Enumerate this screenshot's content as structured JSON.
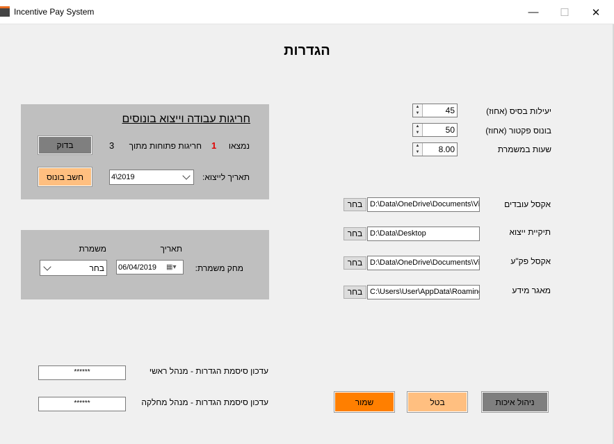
{
  "window": {
    "title": "Incentive Pay System",
    "minimize": "—",
    "maximize": "☐",
    "close": "✕"
  },
  "page_title": "הגדרות",
  "settings": {
    "base_efficiency_label": "יעילות בסיס (אחוז)",
    "base_efficiency_value": "45",
    "factor_bonus_label": "בונוס פקטור (אחוז)",
    "factor_bonus_value": "50",
    "shift_hours_label": "שעות במשמרת",
    "shift_hours_value": "8.00"
  },
  "paths": {
    "browse_label": "בחר",
    "employees_excel_label": "אקסל עובדים",
    "employees_excel_value": "D:\\Data\\OneDrive\\Documents\\Visual",
    "export_folder_label": "תיקיית ייצוא",
    "export_folder_value": "D:\\Data\\Desktop",
    "pkaa_excel_label": "אקסל פק\"ע",
    "pkaa_excel_value": "D:\\Data\\OneDrive\\Documents\\Visual",
    "database_label": "מאגר מידע",
    "database_value": "C:\\Users\\User\\AppData\\Roaming\\Inc"
  },
  "bonus_panel": {
    "heading": "חריגות עבודה וייצוא בונוסים",
    "found_label": "נמצאו",
    "found_count": "1",
    "open_exceptions_label": "חריגות פתוחות מתוך",
    "open_exceptions_total": "3",
    "check_button": "בדוק",
    "export_date_label": "תאריך לייצוא:",
    "export_date_value": "4\\2019",
    "calc_bonus_button": "חשב בונוס"
  },
  "shift_panel": {
    "date_header": "תאריך",
    "shift_header": "משמרת",
    "delete_shift_label": "מחק משמרת:",
    "date_value": "06/04/2019",
    "shift_value": "בחר"
  },
  "passwords": {
    "main_manager_label": "עדכון סיסמת הגדרות - מנהל ראשי",
    "main_manager_value": "******",
    "dept_manager_label": "עדכון סיסמת הגדרות - מנהל מחלקה",
    "dept_manager_value": "******"
  },
  "actions": {
    "save": "שמור",
    "cancel": "בטל",
    "quality_management": "ניהול איכות"
  },
  "colors": {
    "orange": "#ff7f00",
    "light_orange": "#ffbf80",
    "dark_gray": "#7f7f7f",
    "panel_gray": "#bfbfbf",
    "found_count": "#e00000"
  }
}
